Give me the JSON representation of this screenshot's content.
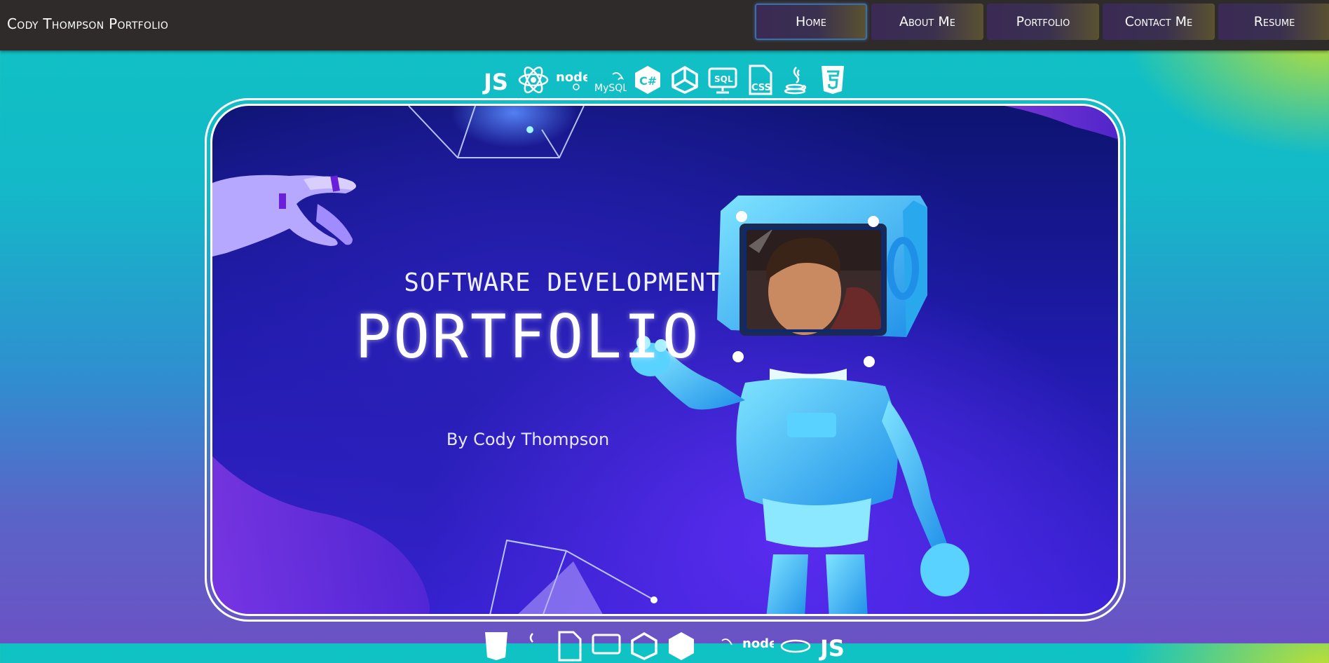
{
  "header": {
    "brand": "Cody Thompson Portfolio"
  },
  "nav": {
    "items": [
      {
        "label": "Home",
        "active": true
      },
      {
        "label": "About Me",
        "active": false
      },
      {
        "label": "Portfolio",
        "active": false
      },
      {
        "label": "Contact Me",
        "active": false
      },
      {
        "label": "Resume",
        "active": false
      }
    ]
  },
  "tech_icons": {
    "js": "JS",
    "node": "node",
    "mysql": "MySQL",
    "csharp": "C#",
    "sql": "SQL",
    "css": "CSS",
    "names": [
      "javascript-icon",
      "react-icon",
      "nodejs-icon",
      "mysql-icon",
      "csharp-icon",
      "unity-icon",
      "sql-icon",
      "css-icon",
      "java-icon",
      "html5-icon"
    ]
  },
  "hero": {
    "subtitle": "SOFTWARE DEVELOPMENT",
    "title": "PORTFOLIO",
    "byline": "By Cody Thompson"
  },
  "colors": {
    "topbar": "#2f2b2b",
    "card_bg": "#1e1aa8",
    "robot": "#3ec6f5",
    "accent_lime": "#cde128"
  }
}
